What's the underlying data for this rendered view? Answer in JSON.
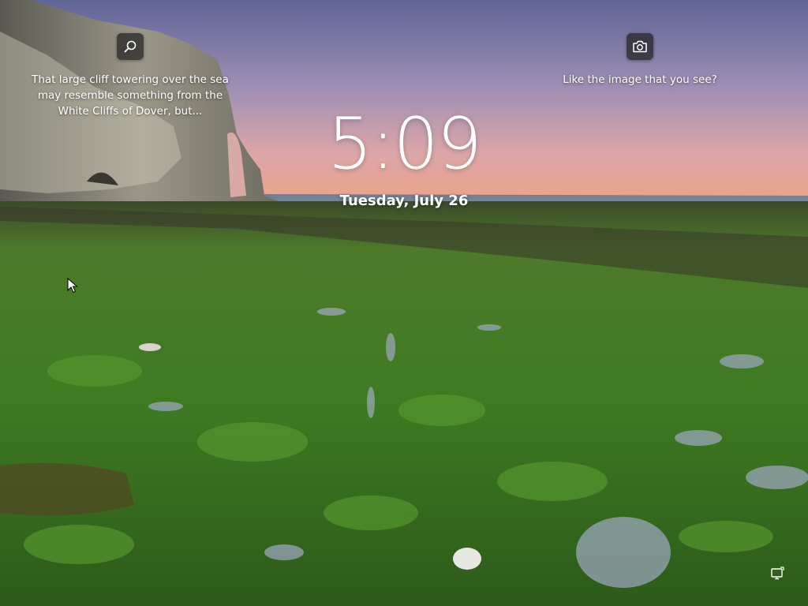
{
  "lock_screen": {
    "time": "5:09",
    "date": "Tuesday, July 26",
    "spotlight": {
      "search_icon": "search-icon",
      "image_description": "That large cliff towering over the sea\nmay resemble something from the\nWhite Cliffs of Dover, but...",
      "camera_icon": "camera-icon",
      "like_prompt": "Like the image that you see?"
    },
    "status_icons": {
      "network": "network-icon"
    }
  },
  "colors": {
    "text": "#ffffff",
    "button_bg": "#202020",
    "sky_top": "#6b6f9b",
    "sky_horizon": "#e89c8c",
    "sea": "#7a879a",
    "moss": "#3f7a22"
  }
}
